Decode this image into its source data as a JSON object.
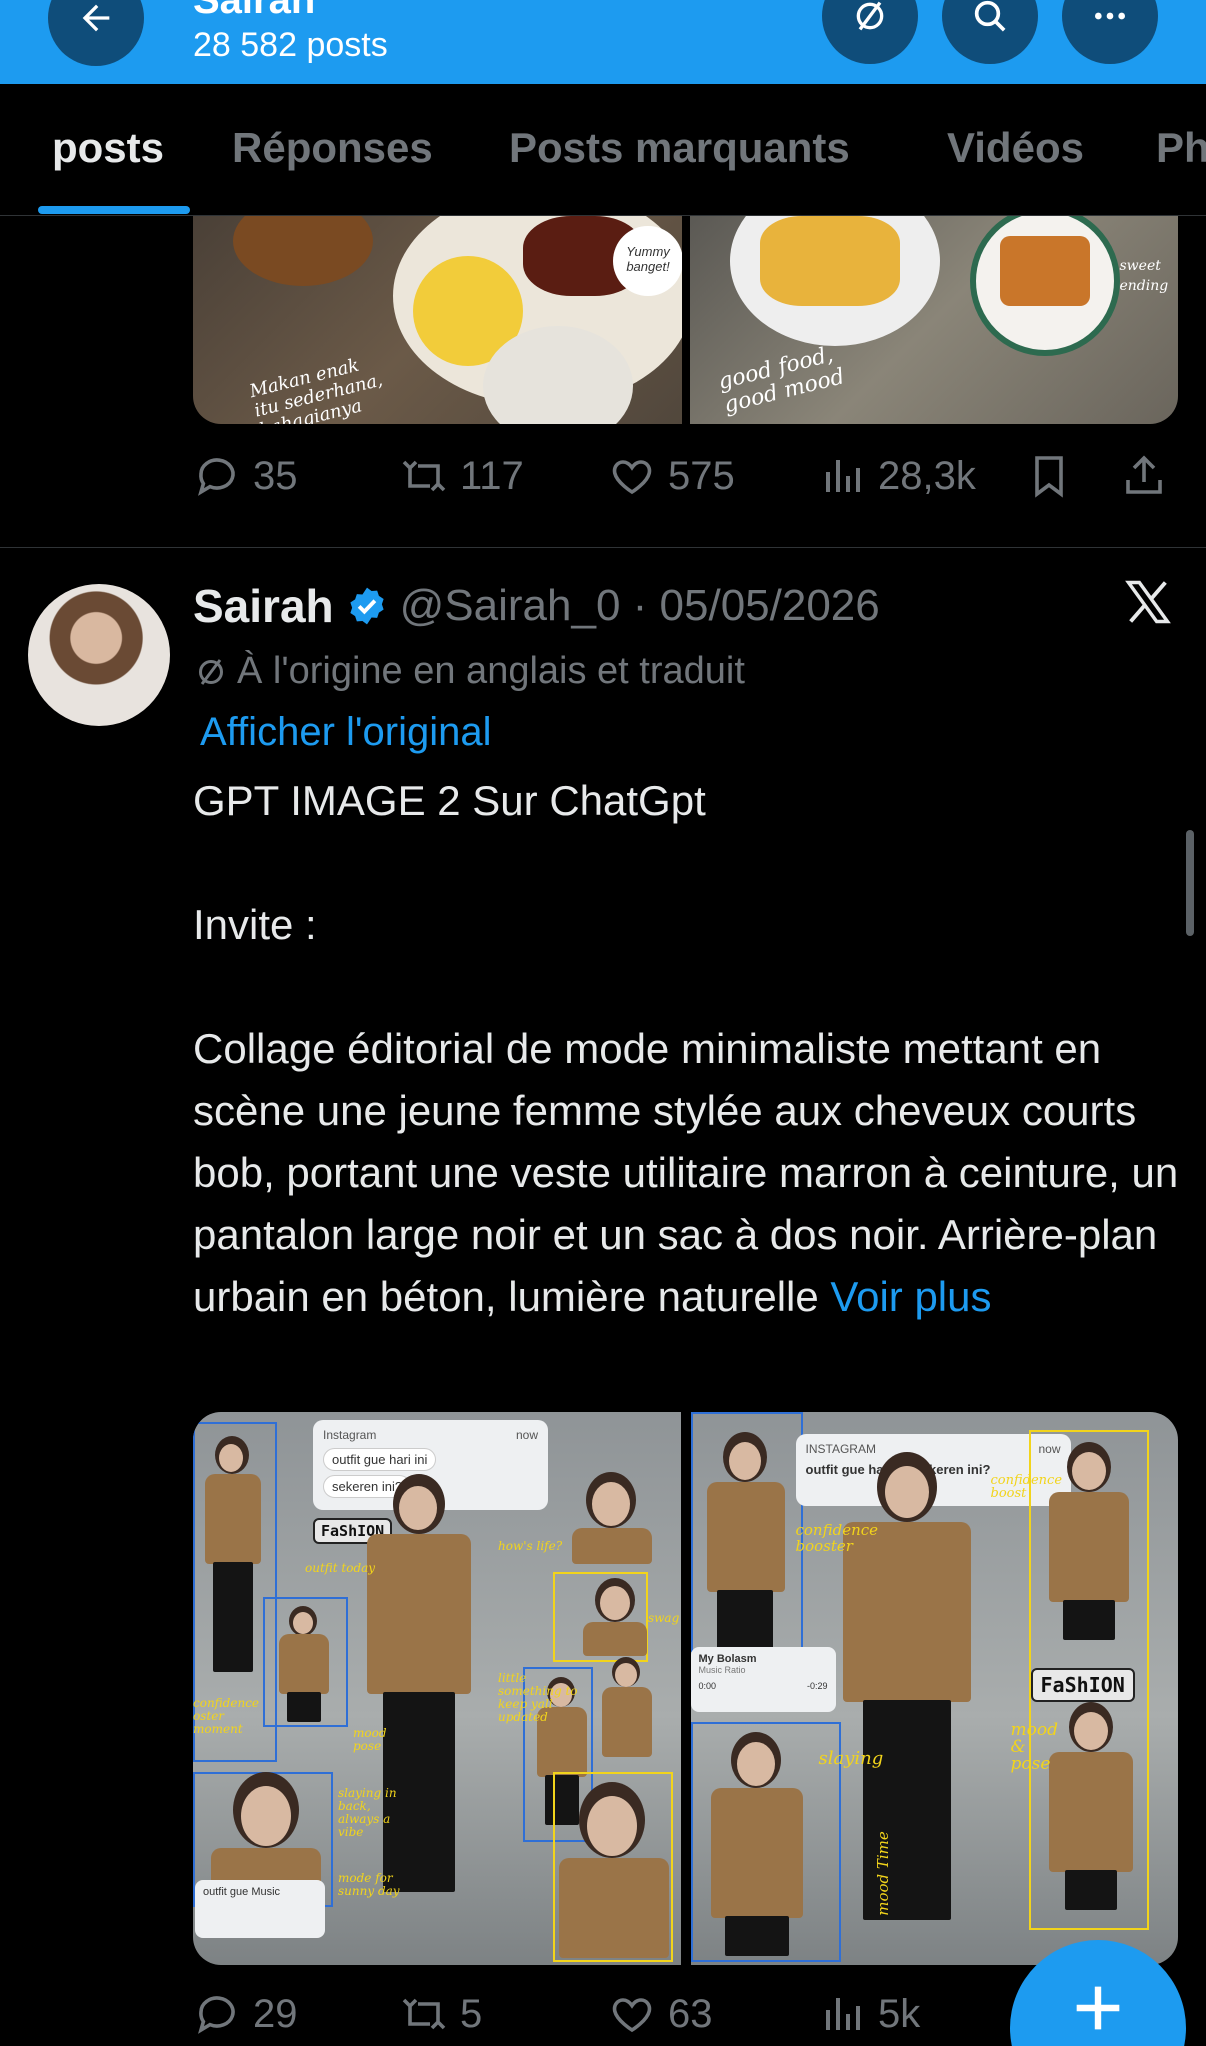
{
  "header": {
    "title": "Sairah",
    "post_count": "28 582 posts"
  },
  "tabs": [
    {
      "label": "posts",
      "active": true
    },
    {
      "label": "Réponses"
    },
    {
      "label": "Posts marquants"
    },
    {
      "label": "Vidéos"
    },
    {
      "label": "Ph"
    }
  ],
  "post1": {
    "media_captions": {
      "left_1": "Makan enak",
      "left_2": "itu sederhana,",
      "left_3": "bahagianya",
      "left_bubble": "Yummy banget!",
      "right_1": "good food,",
      "right_2": "good mood",
      "right_tag": "sweet ending"
    },
    "actions": {
      "replies": "35",
      "reposts": "117",
      "likes": "575",
      "views": "28,3k"
    }
  },
  "post2": {
    "author_name": "Sairah",
    "handle_date": "@Sairah_0 · 05/05/2026",
    "translated_note": "À l'origine en anglais et traduit",
    "show_original": "Afficher l'original",
    "line_title": "GPT IMAGE 2 Sur ChatGpt",
    "line_invite": "Invite :",
    "line_body": "Collage éditorial de mode minimaliste mettant en scène une jeune femme stylée aux cheveux courts bob, portant une veste utilitaire marron à ceinture, un pantalon large noir et un sac à dos noir. Arrière-plan urbain en béton, lumière naturelle",
    "see_more": "Voir plus",
    "media": {
      "left": {
        "ig_label": "Instagram",
        "ig_time": "now",
        "bubble1": "outfit gue hari ini",
        "bubble2": "sekeren ini?",
        "fashion": "FaShION",
        "doodle_outfit": "outfit today",
        "doodle_life": "how's life?",
        "doodle_conf": "confidence oster moment",
        "doodle_mood": "mood pose",
        "doodle_slay": "slaying in back, always a vibe",
        "doodle_sunny": "mode for sunny day",
        "doodle_update": "little something to keep yall updated",
        "doodle_swag": "swag",
        "music": "outfit gue Music"
      },
      "right": {
        "ig_label": "INSTAGRAM",
        "ig_time": "now",
        "bubble": "outfit gue hari ini sekeren ini?",
        "fashion": "FaShION",
        "doodle_conf": "confidence booster",
        "doodle_conf2": "confidence boost",
        "doodle_slaying": "slaying",
        "doodle_mood": "mood & pose",
        "doodle_moodtime": "mood Time",
        "music_title": "My Bolasm",
        "music_sub": "Music Ratio",
        "music_start": "0:00",
        "music_end": "-0:29"
      }
    },
    "actions": {
      "replies": "29",
      "reposts": "5",
      "likes": "63",
      "views": "5k"
    }
  },
  "colors": {
    "accent": "#1d9bf0",
    "muted": "#71767b",
    "background": "#000000"
  }
}
